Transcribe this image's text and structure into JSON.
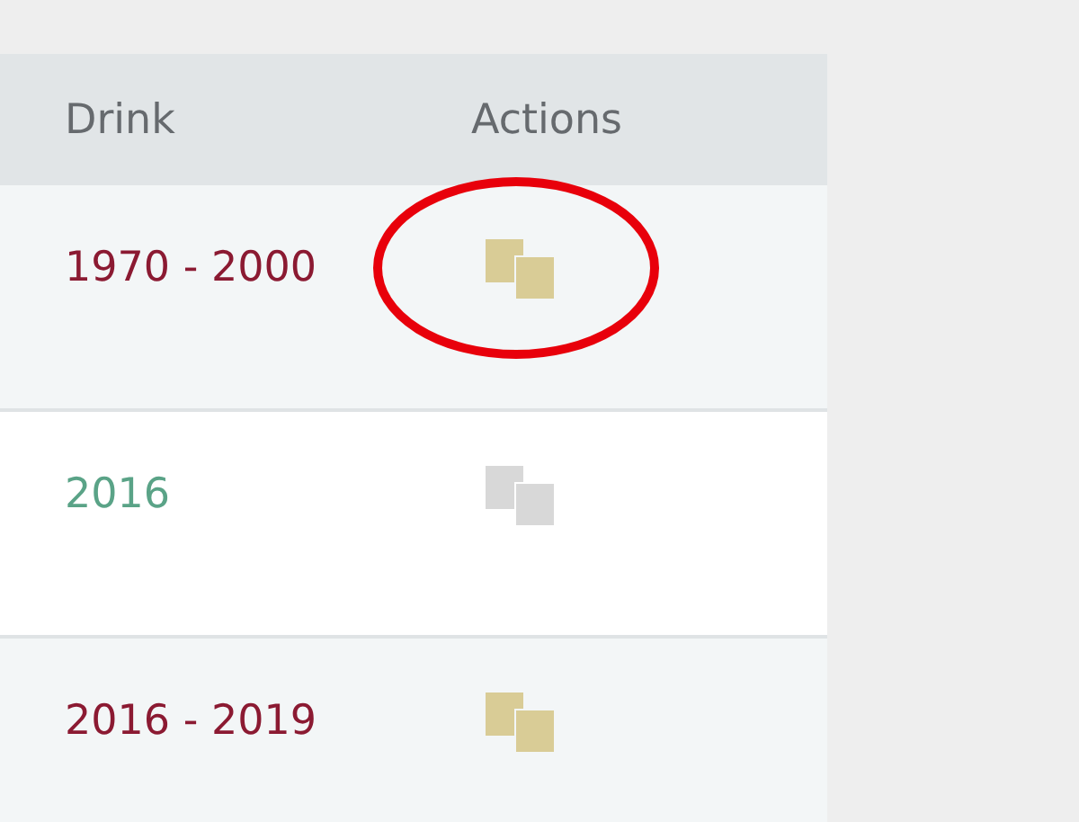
{
  "table": {
    "columns": [
      "Drink",
      "Actions"
    ],
    "rows": [
      {
        "drink": "1970 - 2000",
        "color": "#8b1a32",
        "copy_disabled": false,
        "circled": true
      },
      {
        "drink": "2016",
        "color": "#5aa387",
        "copy_disabled": true,
        "circled": false
      },
      {
        "drink": "2016 - 2019",
        "color": "#8b1a32",
        "copy_disabled": false,
        "circled": false
      }
    ]
  }
}
